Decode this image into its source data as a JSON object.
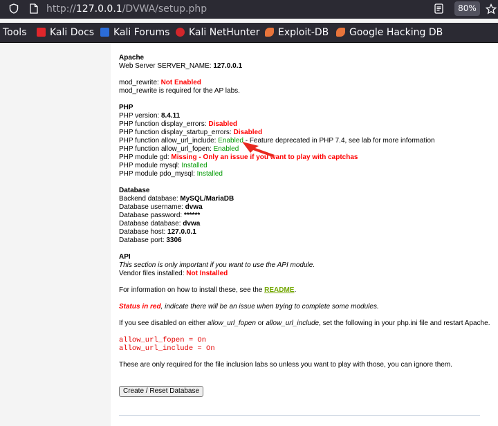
{
  "browser": {
    "url_scheme": "http://",
    "url_host": "127.0.0.1",
    "url_path": "/DVWA/setup.php",
    "zoom": "80%"
  },
  "bookmarks": [
    {
      "label": "Tools",
      "color": ""
    },
    {
      "label": "Kali Docs",
      "color": "#e0262b"
    },
    {
      "label": "Kali Forums",
      "color": "#2b6cd8"
    },
    {
      "label": "Kali NetHunter",
      "color": "#d3262b"
    },
    {
      "label": "Exploit-DB",
      "color": "#e8743b"
    },
    {
      "label": "Google Hacking DB",
      "color": "#e8743b"
    }
  ],
  "apache": {
    "heading": "Apache",
    "server_name_label": "Web Server SERVER_NAME: ",
    "server_name_value": "127.0.0.1",
    "mod_rewrite_label": "mod_rewrite: ",
    "mod_rewrite_value": "Not Enabled",
    "mod_rewrite_note": "mod_rewrite is required for the AP labs."
  },
  "php": {
    "heading": "PHP",
    "version_label": "PHP version: ",
    "version_value": "8.4.11",
    "display_errors_label": "PHP function display_errors: ",
    "display_errors_value": "Disabled",
    "display_startup_errors_label": "PHP function display_startup_errors: ",
    "display_startup_errors_value": "Disabled",
    "allow_url_include_label": "PHP function allow_url_include: ",
    "allow_url_include_value": "Enabled",
    "allow_url_include_note": " - Feature deprecated in PHP 7.4, see lab for more information",
    "allow_url_fopen_label": "PHP function allow_url_fopen: ",
    "allow_url_fopen_value": "Enabled",
    "gd_label": "PHP module gd: ",
    "gd_value": "Missing - Only an issue if you want to play with captchas",
    "mysql_label": "PHP module mysql: ",
    "mysql_value": "Installed",
    "pdo_mysql_label": "PHP module pdo_mysql: ",
    "pdo_mysql_value": "Installed"
  },
  "database": {
    "heading": "Database",
    "backend_label": "Backend database: ",
    "backend_value": "MySQL/MariaDB",
    "username_label": "Database username: ",
    "username_value": "dvwa",
    "password_label": "Database password: ",
    "password_value": "******",
    "database_label": "Database database: ",
    "database_value": "dvwa",
    "host_label": "Database host: ",
    "host_value": "127.0.0.1",
    "port_label": "Database port: ",
    "port_value": "3306"
  },
  "api": {
    "heading": "API",
    "note": "This section is only important if you want to use the API module.",
    "vendor_label": "Vendor files installed: ",
    "vendor_value": "Not Installed"
  },
  "info": {
    "install_prefix": "For information on how to install these, see the ",
    "readme_link": "README",
    "install_suffix": ".",
    "status_red": "Status in red",
    "status_suffix": ", indicate there will be an issue when trying to complete some modules.",
    "disabled_prefix": "If you see disabled on either ",
    "allow_url_fopen": "allow_url_fopen",
    "or_text": " or ",
    "allow_url_include": "allow_url_include",
    "disabled_suffix": ", set the following in your php.ini file and restart Apache.",
    "code_line_1": "allow_url_fopen = On",
    "code_line_2": "allow_url_include = On",
    "inclusion_note": "These are only required for the file inclusion labs so unless you want to play with those, you can ignore them."
  },
  "button": {
    "label": "Create / Reset Database"
  }
}
